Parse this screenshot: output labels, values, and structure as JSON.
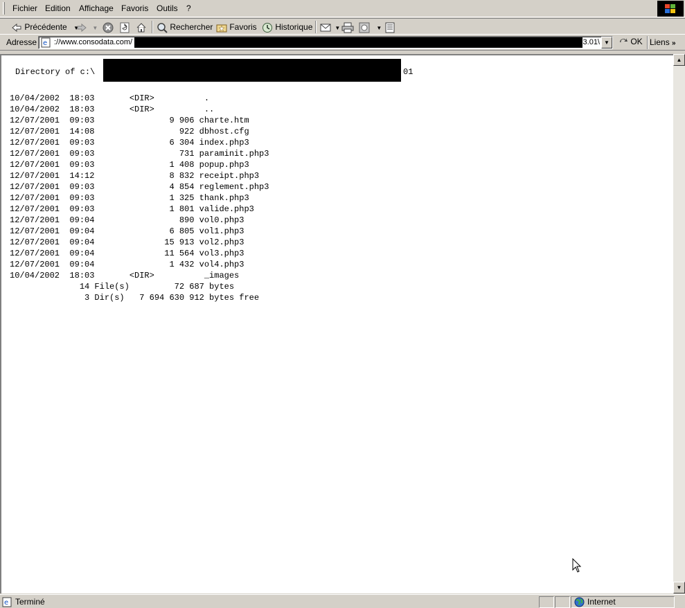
{
  "menu": [
    "Fichier",
    "Edition",
    "Affichage",
    "Favoris",
    "Outils",
    "?"
  ],
  "toolbar": {
    "back": "Précédente",
    "search": "Rechercher",
    "favorites": "Favoris",
    "history": "Historique"
  },
  "address": {
    "label": "Adresse",
    "url_visible": "://www.consodata.com/",
    "url_suffix": "13.01\\",
    "go": "OK",
    "links": "Liens"
  },
  "listing": {
    "header": "Directory of c:\\",
    "header_suffix": "01",
    "rows": [
      "10/04/2002  18:03       <DIR>          .",
      "10/04/2002  18:03       <DIR>          ..",
      "12/07/2001  09:03               9 906 charte.htm",
      "12/07/2001  14:08                 922 dbhost.cfg",
      "12/07/2001  09:03               6 304 index.php3",
      "12/07/2001  09:03                 731 paraminit.php3",
      "12/07/2001  09:03               1 408 popup.php3",
      "12/07/2001  14:12               8 832 receipt.php3",
      "12/07/2001  09:03               4 854 reglement.php3",
      "12/07/2001  09:03               1 325 thank.php3",
      "12/07/2001  09:03               1 801 valide.php3",
      "12/07/2001  09:04                 890 vol0.php3",
      "12/07/2001  09:04               6 805 vol1.php3",
      "12/07/2001  09:04              15 913 vol2.php3",
      "12/07/2001  09:04              11 564 vol3.php3",
      "12/07/2001  09:04               1 432 vol4.php3",
      "10/04/2002  18:03       <DIR>          _images",
      "              14 File(s)         72 687 bytes",
      "               3 Dir(s)   7 694 630 912 bytes free"
    ]
  },
  "status": {
    "text": "Terminé",
    "zone": "Internet"
  }
}
